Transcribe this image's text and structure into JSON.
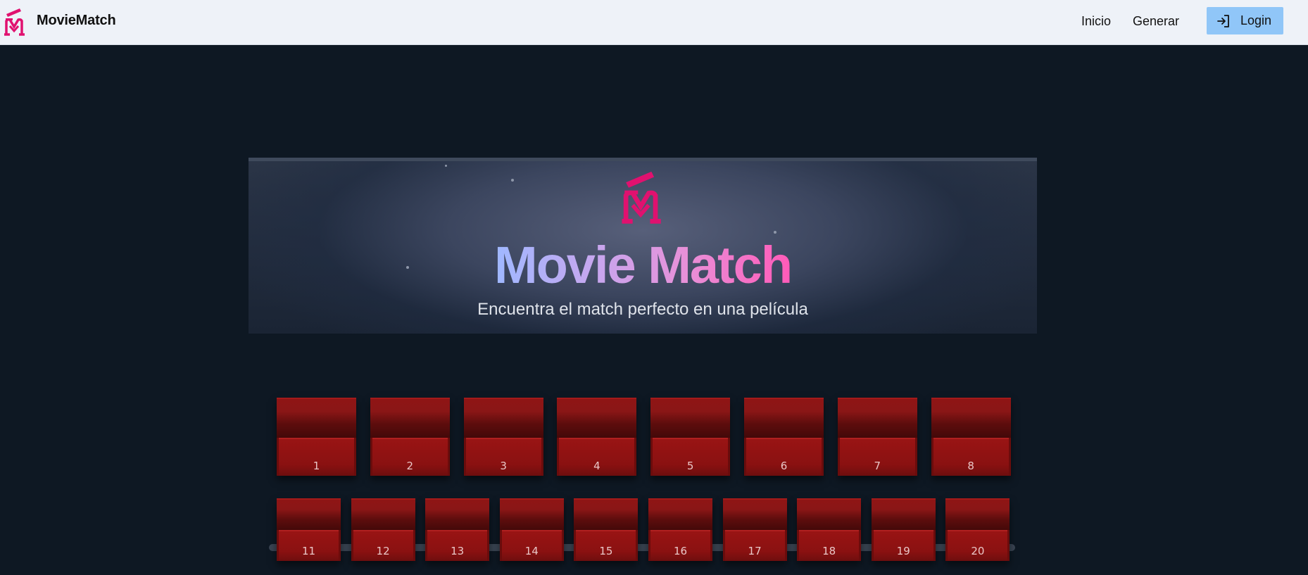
{
  "navbar": {
    "brand": "MovieMatch",
    "links": [
      {
        "label": "Inicio"
      },
      {
        "label": "Generar"
      }
    ],
    "login_label": "Login"
  },
  "hero": {
    "title": "Movie Match",
    "subtitle": "Encuentra el match perfecto en una película"
  },
  "colors": {
    "brand_pink": "#e0116f",
    "background": "#0e1823",
    "navbar_bg": "#eef2f8",
    "login_bg": "#90c6f8",
    "seat_red": "#8f1515"
  },
  "icons": {
    "brand": "moviematch-logo-icon",
    "login": "login-arrow-icon"
  },
  "seats": {
    "row1": [
      "1",
      "2",
      "3",
      "4",
      "5",
      "6",
      "7",
      "8"
    ],
    "row2": [
      "11",
      "12",
      "13",
      "14",
      "15",
      "16",
      "17",
      "18",
      "19",
      "20"
    ]
  }
}
